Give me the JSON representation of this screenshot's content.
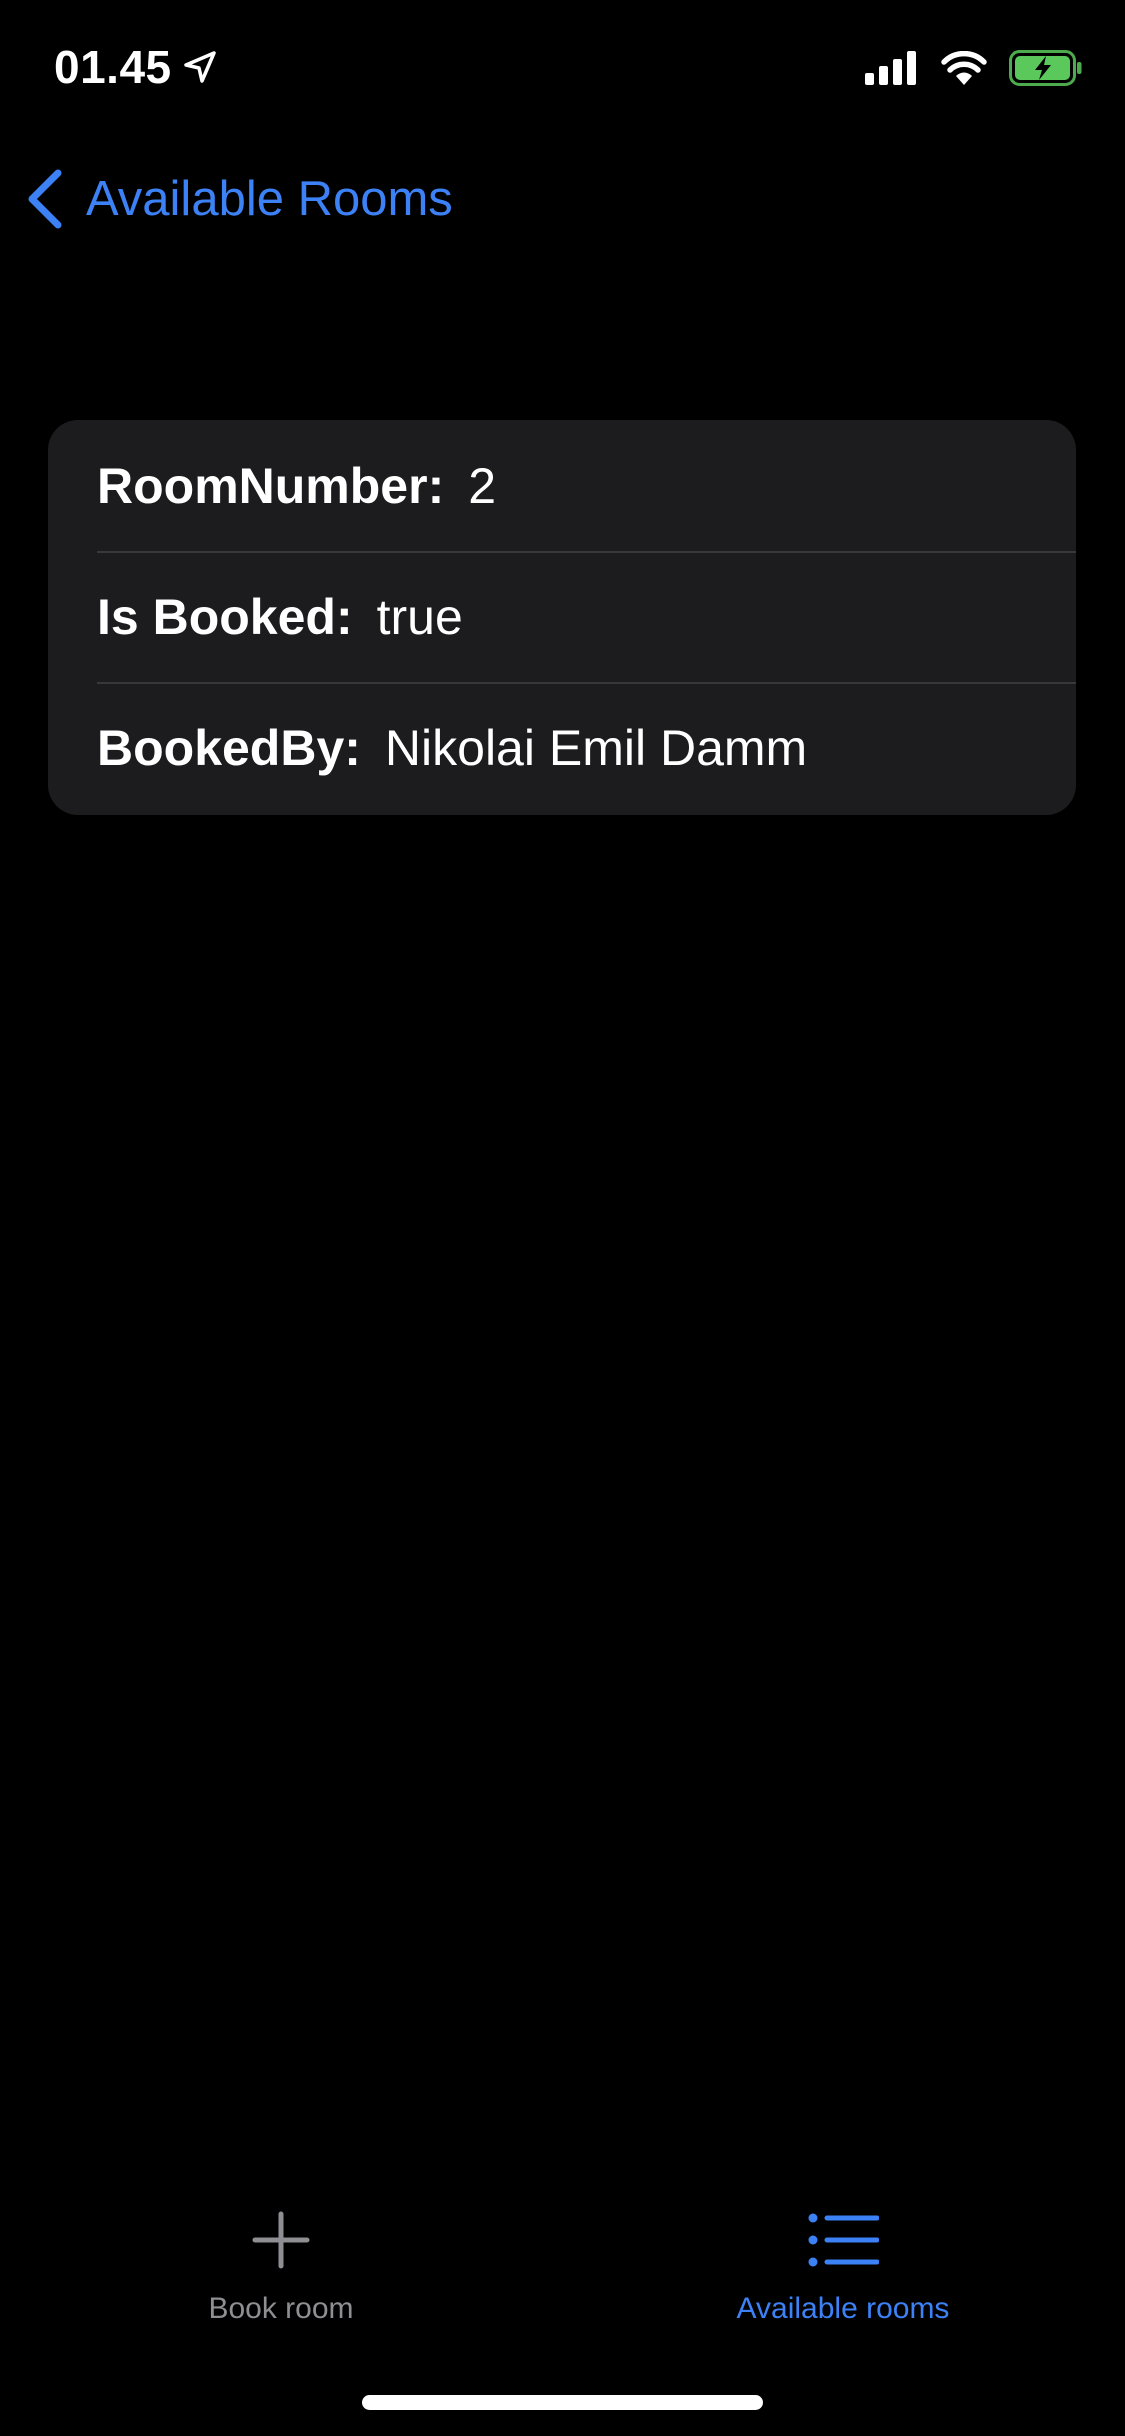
{
  "status_bar": {
    "time": "01.45",
    "location_icon": "location-arrow-icon",
    "signal_icon": "cellular-signal-icon",
    "wifi_icon": "wifi-icon",
    "battery_icon": "battery-charging-icon"
  },
  "nav": {
    "back_label": "Available Rooms",
    "back_icon": "chevron-left-icon"
  },
  "room": {
    "rows": [
      {
        "label": "RoomNumber:",
        "value": "2"
      },
      {
        "label": "Is Booked:",
        "value": "true"
      },
      {
        "label": "BookedBy:",
        "value": "Nikolai Emil Damm"
      }
    ]
  },
  "tabs": [
    {
      "label": "Book room",
      "icon": "plus-icon",
      "active": false
    },
    {
      "label": "Available rooms",
      "icon": "list-icon",
      "active": true
    }
  ],
  "colors": {
    "background": "#000000",
    "card": "#1c1c1e",
    "accent": "#3c82f6",
    "inactive": "#8e8e93",
    "battery": "#5ac85a"
  }
}
